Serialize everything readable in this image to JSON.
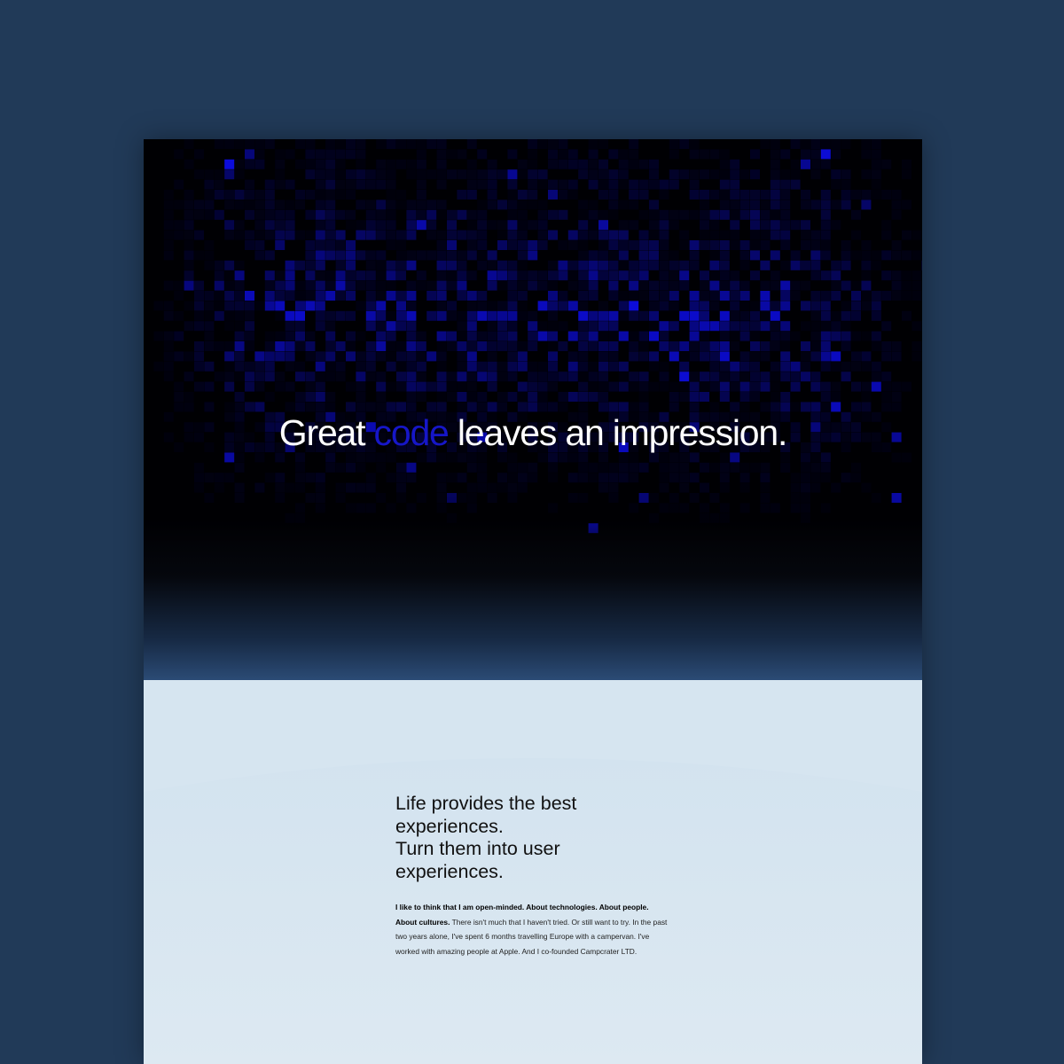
{
  "colors": {
    "backdrop": "#213a58",
    "hero_bg": "#000003",
    "accent_blue": "#1616c8",
    "horizon_blue": "#2b4b75",
    "light_section": "#d6e5f0",
    "pixel_tint": "#0a0ad8"
  },
  "hero": {
    "headline": {
      "before": "Great",
      "accent": "code",
      "after": "leaves an impression."
    }
  },
  "intro": {
    "heading_lines": [
      "Life provides the best",
      "experiences.",
      "Turn them into user",
      "experiences."
    ],
    "body_bold": "I like to think that I am open-minded. About technologies. About people. About cultures.",
    "body_text": "There isn't much that I haven't tried. Or still want to try. In the past two years alone, I've spent 6 months travelling Europe with a campervan. I've worked with amazing people at Apple. And I co-founded Campcrater LTD."
  }
}
